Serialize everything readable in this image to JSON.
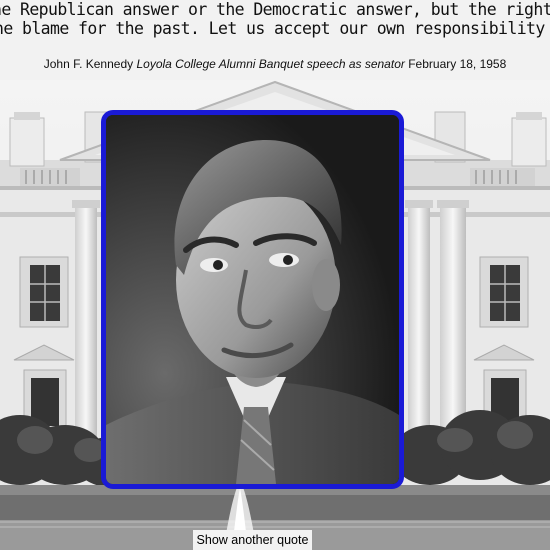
{
  "quote": {
    "line1": "he Republican answer or the Democratic answer, but the right answer",
    "line2": "he blame for the past. Let us accept our own responsibility for the f"
  },
  "attribution": {
    "author": "John F. Kennedy",
    "venue": "Loyola College Alumni Banquet speech as senator",
    "date": "February 18, 1958"
  },
  "portrait": {
    "subject": "John F. Kennedy portrait",
    "frame_color": "#1a1ad6"
  },
  "background": {
    "scene": "White House north facade"
  },
  "controls": {
    "show_quote_label": "Show another quote"
  }
}
